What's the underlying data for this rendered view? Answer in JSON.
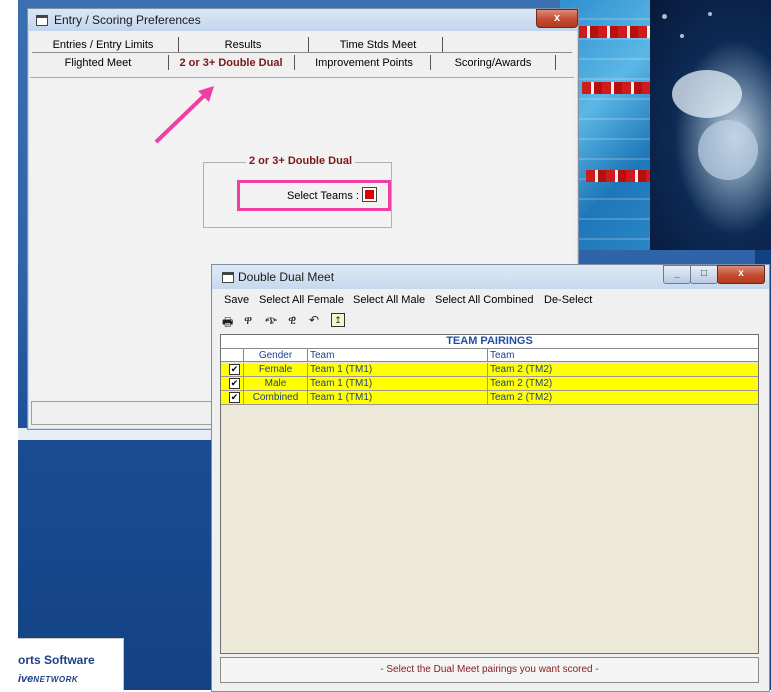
{
  "background": {
    "brand_line1": "orts Software",
    "brand_line2": "ive",
    "brand_line2_suffix": "NETWORK"
  },
  "prefs_window": {
    "title": "Entry / Scoring Preferences",
    "close_glyph": "x",
    "tabs_top": [
      {
        "label": "Entries / Entry Limits"
      },
      {
        "label": "Results"
      },
      {
        "label": "Time Stds Meet"
      }
    ],
    "tabs_bottom": [
      {
        "label": "Flighted Meet"
      },
      {
        "label": "2 or 3+ Double Dual"
      },
      {
        "label": "Improvement Points"
      },
      {
        "label": "Scoring/Awards"
      }
    ],
    "active_tab": "2 or 3+ Double Dual",
    "group_title": "2 or 3+ Double Dual",
    "select_teams_label": "Select Teams :"
  },
  "dual_window": {
    "title": "Double Dual Meet",
    "menu": [
      {
        "label": "Save"
      },
      {
        "label": "Select All Female"
      },
      {
        "label": "Select All Male"
      },
      {
        "label": "Select All Combined"
      },
      {
        "label": "De-Select"
      }
    ],
    "toolbar_icons": [
      "printer-icon",
      "filter-female-icon",
      "filter-male-icon",
      "filter-combined-icon",
      "undo-icon",
      "exit-icon"
    ],
    "grid_title": "TEAM PAIRINGS",
    "columns": [
      "Gender",
      "Team",
      "Team"
    ],
    "rows": [
      {
        "checked": "✔",
        "gender": "Female",
        "team_a": "Team 1 (TM1)",
        "team_b": "Team 2 (TM2)"
      },
      {
        "checked": "✔",
        "gender": "Male",
        "team_a": "Team 1 (TM1)",
        "team_b": "Team 2 (TM2)"
      },
      {
        "checked": "✔",
        "gender": "Combined",
        "team_a": "Team 1 (TM1)",
        "team_b": "Team 2 (TM2)"
      }
    ],
    "status": "- Select the Dual Meet pairings you want scored -"
  },
  "colors": {
    "highlight": "#ef3fa4",
    "row_highlight": "#ffff00",
    "accent_red": "#7a1818",
    "grid_text": "#1f3f8a"
  }
}
